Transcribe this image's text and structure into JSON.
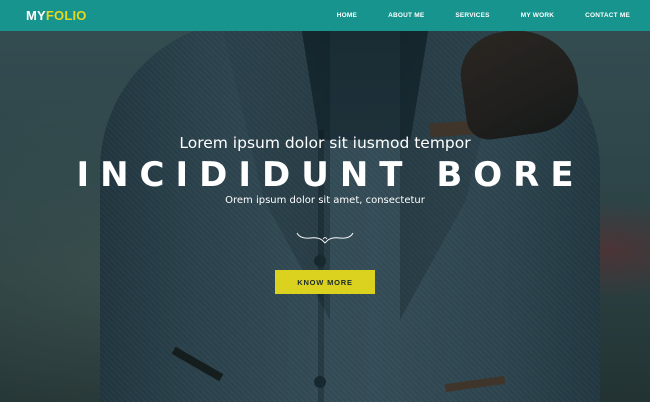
{
  "brand": {
    "my": "MY",
    "folio": "FOLIO",
    "colors": {
      "nav_bg": "#16948d",
      "accent_yellow": "#dbd11f",
      "logo_yellow": "#e6d81f"
    }
  },
  "nav": {
    "items": [
      {
        "label": "HOME"
      },
      {
        "label": "ABOUT ME"
      },
      {
        "label": "SERVICES"
      },
      {
        "label": "MY WORK"
      },
      {
        "label": "CONTACT ME"
      }
    ]
  },
  "hero": {
    "subhead": "Lorem ipsum dolor sit iusmod tempor",
    "headline": "INCIDIDUNT BORE",
    "tagline": "Orem ipsum dolor sit amet, consectetur",
    "divider_icon": "ornamental-divider-icon",
    "cta_label": "KNOW MORE",
    "background_image": "man-in-tweed-jacket-photo"
  }
}
